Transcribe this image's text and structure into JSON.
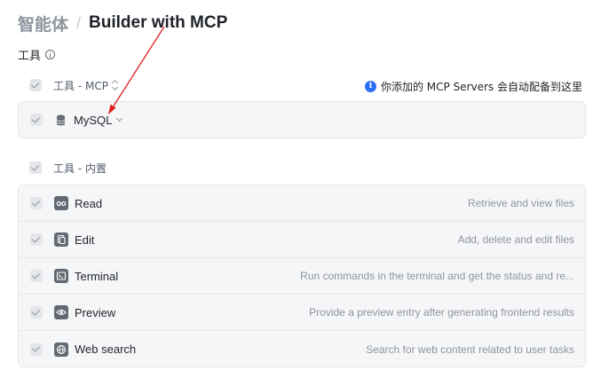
{
  "header": {
    "parent": "智能体",
    "separator": "/",
    "title": "Builder with MCP"
  },
  "tools_section": {
    "title": "工具"
  },
  "mcp_group": {
    "label": "工具 - MCP",
    "notice": "你添加的 MCP Servers 会自动配备到这里",
    "items": [
      {
        "name": "MySQL",
        "icon": "database-icon"
      }
    ]
  },
  "builtin_group": {
    "label": "工具 - 内置",
    "items": [
      {
        "name": "Read",
        "description": "Retrieve and view files",
        "icon": "glasses-icon"
      },
      {
        "name": "Edit",
        "description": "Add, delete and edit files",
        "icon": "file-edit-icon"
      },
      {
        "name": "Terminal",
        "description": "Run commands in the terminal and get the status and re...",
        "icon": "terminal-icon"
      },
      {
        "name": "Preview",
        "description": "Provide a preview entry after generating frontend results",
        "icon": "eye-icon"
      },
      {
        "name": "Web search",
        "description": "Search for web content related to user tasks",
        "icon": "globe-icon"
      }
    ]
  },
  "colors": {
    "accent": "#2a6ef5",
    "annotation_arrow": "#e02020",
    "panel_bg": "#f5f6f7"
  }
}
